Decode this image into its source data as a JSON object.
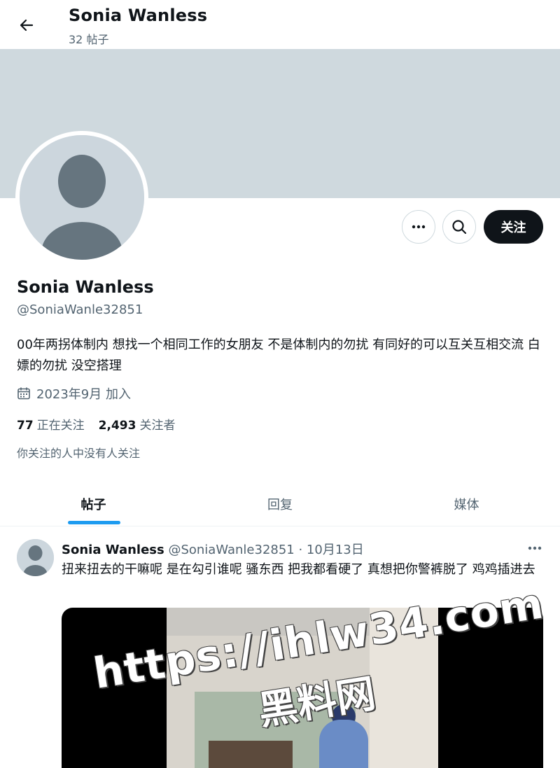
{
  "header": {
    "back_icon": "arrow-left-icon",
    "title": "Sonia Wanless",
    "post_count": "32 帖子"
  },
  "profile": {
    "name": "Sonia Wanless",
    "handle": "@SoniaWanle32851",
    "bio": "00年两拐体制内 想找一个相同工作的女朋友 不是体制内的勿扰 有同好的可以互关互相交流 白嫖的勿扰 没空搭理",
    "joined": "2023年9月 加入",
    "following_count": "77",
    "following_label": "正在关注",
    "followers_count": "2,493",
    "followers_label": "关注者",
    "followed_note": "你关注的人中没有人关注"
  },
  "actions": {
    "more_icon": "more-horizontal-icon",
    "search_icon": "search-icon",
    "follow_label": "关注"
  },
  "tabs": [
    {
      "label": "帖子",
      "active": true
    },
    {
      "label": "回复",
      "active": false
    },
    {
      "label": "媒体",
      "active": false
    }
  ],
  "tweet": {
    "author_name": "Sonia Wanless",
    "author_handle_date": "@SoniaWanle32851 · 10月13日",
    "text": "扭来扭去的干嘛呢 是在勾引谁呢 骚东西 把我都看硬了 真想把你警裤脱了 鸡鸡插进去",
    "more_icon": "more-horizontal-icon"
  },
  "watermark": {
    "line1": "https://ihlw34.com",
    "line2": "黑料网"
  },
  "colors": {
    "accent": "#1d9bf0",
    "banner": "#cfd9de",
    "follow_button": "#0f1419",
    "muted_text": "#536471"
  }
}
